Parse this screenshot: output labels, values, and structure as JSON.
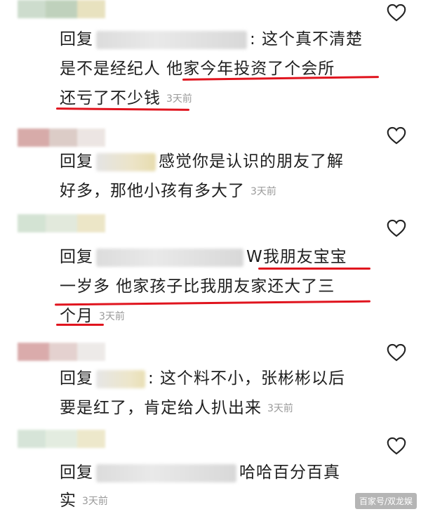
{
  "comments": [
    {
      "reply_label": "回复",
      "line1_after": ": 这个真不清楚",
      "line2": "是不是经纪人 他家今年投资了个会所",
      "line3": "还亏了不少钱",
      "time": "3天前"
    },
    {
      "reply_label": "回复",
      "line1_after": "感觉你是认识的朋友了解",
      "line2": "好多，那他小孩有多大了",
      "time": "3天前"
    },
    {
      "reply_label": "回复",
      "line1_after": "W我朋友宝宝",
      "line2": "一岁多 他家孩子比我朋友家还大了三",
      "line3": "个月",
      "time": "3天前"
    },
    {
      "reply_label": "回复",
      "line1_after": ": 这个料不小，张彬彬以后",
      "line2": "要是红了，肯定给人扒出来",
      "time": "3天前"
    },
    {
      "reply_label": "回复",
      "line1_after": "哈哈百分百真",
      "line2": "实",
      "time": "3天前"
    }
  ],
  "watermark": "百家号/双龙娱",
  "colors": {
    "underline": "#e0141e",
    "timestamp": "#9a9a9a",
    "text": "#1f1f1f"
  },
  "icons": {
    "like": "heart-outline-icon"
  }
}
